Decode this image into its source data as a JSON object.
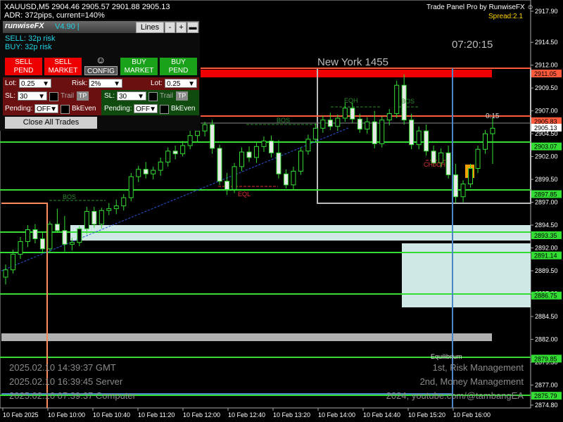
{
  "header": {
    "symbol_line": "XAUUSD,M5  2904.46 2905.57 2901.88 2905.13",
    "adr_line": "ADR: 372pips, current=140%",
    "panel_title": "Trade Panel Pro by RunwiseFX",
    "spread": "Spread:2.1"
  },
  "panel": {
    "brand": "runwiseFX",
    "version": "V4.90 |",
    "lines_btn": "Lines",
    "minus_btn": "-",
    "plus_btn": "+",
    "min_btn": "▬",
    "sell_risk": "SELL: 32p risk",
    "buy_risk": "BUY: 32p risk",
    "sell_pend": [
      "SELL",
      "PEND"
    ],
    "sell_market": [
      "SELL",
      "MARKET"
    ],
    "config": "CONFIG",
    "smiley": "☺",
    "buy_market": [
      "BUY",
      "MARKET"
    ],
    "buy_pend": [
      "BUY",
      "PEND"
    ],
    "lot_label": "Lot:",
    "lot_value": "0.25",
    "risk_label": "Risk:",
    "risk_value": "2%",
    "lot2_label": "Lot:",
    "lot2_value": "0.25",
    "sl_label": "SL:",
    "sl_value": "30",
    "trail_label": "Trail",
    "tp_label": "TP",
    "sl2_label": "SL:",
    "sl2_value": "30",
    "trail2_label": "Trail",
    "tp2_label": "TP",
    "pending_label": "Pending:",
    "pending_value": "OFF",
    "bkeven_label": "BkEven",
    "pending2_label": "Pending:",
    "pending2_value": "OFF",
    "bkeven2_label": "BkEven",
    "close_all": "Close All Trades"
  },
  "chart_text": {
    "session": "New York  1455",
    "clock": "07:20:15",
    "countdown": "0:15",
    "eqh": "EQH",
    "eql": "EQL",
    "bos_1": "BOS",
    "bos_2": "BOS",
    "bos_3": "BOS",
    "choch": "CHoCH",
    "equilibrium": "Equilibrium",
    "gmt": "2025.02.10 14:39:37 GMT",
    "server": "2025.02.10 16:39:45 Server",
    "computer": "2025.02.10 07:39:37 Computer",
    "rule1": "1st, Risk Management",
    "rule2": "2nd, Money Management",
    "credit": "2024, youtube.com/@tambangEA"
  },
  "price_axis": {
    "ticks": [
      "2917.90",
      "2914.50",
      "2912.00",
      "2909.50",
      "2907.00",
      "2904.50",
      "2902.00",
      "2899.50",
      "2897.00",
      "2894.50",
      "2892.00",
      "2889.50",
      "2887.00",
      "2884.50",
      "2882.00",
      "2879.50",
      "2877.00",
      "2874.80"
    ],
    "labels": [
      {
        "text": "2911.05",
        "color": "#ff5a3c"
      },
      {
        "text": "2905.83",
        "color": "#ff5a3c"
      },
      {
        "text": "2905.13",
        "color": "#ffffff"
      },
      {
        "text": "2903.07",
        "color": "#33dd33"
      },
      {
        "text": "2897.85",
        "color": "#33dd33"
      },
      {
        "text": "2893.35",
        "color": "#33dd33"
      },
      {
        "text": "2891.14",
        "color": "#33dd33"
      },
      {
        "text": "2886.75",
        "color": "#33dd33"
      },
      {
        "text": "2879.85",
        "color": "#33dd33"
      },
      {
        "text": "2875.79",
        "color": "#33dd33"
      }
    ]
  },
  "time_axis": [
    "10 Feb 2025",
    "10 Feb 10:00",
    "10 Feb 10:40",
    "10 Feb 11:20",
    "10 Feb 12:00",
    "10 Feb 12:40",
    "10 Feb 13:20",
    "10 Feb 14:00",
    "10 Feb 14:40",
    "10 Feb 15:20",
    "10 Feb 16:00"
  ],
  "candles": [
    [
      2888.8,
      2890.2,
      2888.0,
      2889.6
    ],
    [
      2889.6,
      2891.8,
      2889.2,
      2891.3
    ],
    [
      2891.3,
      2893.2,
      2890.8,
      2892.7
    ],
    [
      2892.7,
      2894.5,
      2892.1,
      2894.0
    ],
    [
      2894.0,
      2894.6,
      2892.5,
      2893.0
    ],
    [
      2893.0,
      2893.8,
      2891.4,
      2891.9
    ],
    [
      2891.9,
      2894.9,
      2891.5,
      2894.6
    ],
    [
      2894.6,
      2896.3,
      2893.8,
      2893.9
    ],
    [
      2893.9,
      2895.5,
      2891.6,
      2892.4
    ],
    [
      2892.4,
      2893.1,
      2891.7,
      2892.6
    ],
    [
      2892.6,
      2894.4,
      2892.2,
      2894.1
    ],
    [
      2894.1,
      2896.5,
      2893.5,
      2896.0
    ],
    [
      2896.0,
      2896.5,
      2894.2,
      2894.6
    ],
    [
      2894.6,
      2896.4,
      2894.1,
      2896.1
    ],
    [
      2896.1,
      2896.9,
      2895.6,
      2896.3
    ],
    [
      2896.3,
      2897.3,
      2895.7,
      2896.6
    ],
    [
      2896.6,
      2897.9,
      2896.1,
      2897.5
    ],
    [
      2897.5,
      2900.2,
      2897.1,
      2899.8
    ],
    [
      2899.8,
      2901.0,
      2899.2,
      2900.6
    ],
    [
      2900.6,
      2901.4,
      2899.6,
      2900.1
    ],
    [
      2900.1,
      2900.9,
      2899.5,
      2900.5
    ],
    [
      2900.5,
      2901.9,
      2899.9,
      2901.4
    ],
    [
      2901.4,
      2903.0,
      2900.9,
      2902.6
    ],
    [
      2902.6,
      2903.2,
      2901.7,
      2902.3
    ],
    [
      2902.3,
      2903.7,
      2902.0,
      2903.2
    ],
    [
      2903.2,
      2904.9,
      2902.8,
      2904.3
    ],
    [
      2904.3,
      2905.4,
      2903.6,
      2904.8
    ],
    [
      2904.8,
      2905.8,
      2904.2,
      2905.5
    ],
    [
      2905.5,
      2906.0,
      2902.3,
      2902.9
    ],
    [
      2902.9,
      2903.3,
      2898.9,
      2899.3
    ],
    [
      2899.3,
      2900.2,
      2897.8,
      2898.4
    ],
    [
      2898.4,
      2901.3,
      2898.0,
      2900.9
    ],
    [
      2900.9,
      2903.0,
      2900.4,
      2902.5
    ],
    [
      2902.5,
      2903.1,
      2901.4,
      2901.9
    ],
    [
      2901.9,
      2903.5,
      2901.3,
      2903.1
    ],
    [
      2903.1,
      2904.2,
      2902.5,
      2903.7
    ],
    [
      2903.7,
      2904.3,
      2901.9,
      2902.4
    ],
    [
      2902.4,
      2903.8,
      2899.6,
      2900.1
    ],
    [
      2900.1,
      2900.6,
      2898.5,
      2898.9
    ],
    [
      2898.9,
      2900.9,
      2898.4,
      2900.4
    ],
    [
      2900.4,
      2903.0,
      2900.0,
      2902.6
    ],
    [
      2902.6,
      2904.4,
      2902.2,
      2903.9
    ],
    [
      2903.9,
      2905.6,
      2903.5,
      2905.1
    ],
    [
      2905.1,
      2906.5,
      2904.6,
      2906.0
    ],
    [
      2906.0,
      2906.8,
      2904.9,
      2905.3
    ],
    [
      2905.3,
      2906.6,
      2904.8,
      2906.2
    ],
    [
      2906.2,
      2907.9,
      2905.8,
      2907.3
    ],
    [
      2907.3,
      2907.9,
      2905.7,
      2906.1
    ],
    [
      2906.1,
      2906.7,
      2904.6,
      2905.0
    ],
    [
      2905.0,
      2906.3,
      2904.5,
      2905.8
    ],
    [
      2905.8,
      2907.0,
      2902.9,
      2903.4
    ],
    [
      2903.4,
      2906.4,
      2903.0,
      2906.0
    ],
    [
      2906.0,
      2907.2,
      2905.4,
      2906.7
    ],
    [
      2906.7,
      2910.3,
      2906.2,
      2909.8
    ],
    [
      2909.8,
      2911.0,
      2905.5,
      2906.0
    ],
    [
      2906.0,
      2906.7,
      2902.8,
      2903.3
    ],
    [
      2903.3,
      2905.3,
      2902.8,
      2904.8
    ],
    [
      2904.8,
      2905.5,
      2902.1,
      2902.6
    ],
    [
      2902.6,
      2903.2,
      2900.9,
      2901.3
    ],
    [
      2901.3,
      2902.9,
      2900.8,
      2902.4
    ],
    [
      2902.4,
      2903.2,
      2899.6,
      2900.0
    ],
    [
      2900.0,
      2901.2,
      2896.9,
      2897.6
    ],
    [
      2897.6,
      2899.4,
      2897.0,
      2899.0
    ],
    [
      2899.0,
      2901.2,
      2898.6,
      2900.7
    ],
    [
      2900.7,
      2903.2,
      2900.2,
      2902.8
    ],
    [
      2902.8,
      2904.9,
      2902.3,
      2904.5
    ],
    [
      2904.5,
      2906.3,
      2901.2,
      2905.1
    ]
  ]
}
